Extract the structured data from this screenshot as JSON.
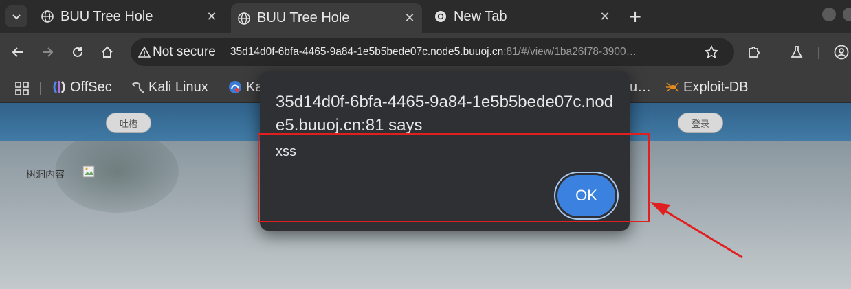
{
  "tabs": [
    {
      "title": "BUU Tree Hole",
      "active": false,
      "favicon": "globe-icon"
    },
    {
      "title": "BUU Tree Hole",
      "active": true,
      "favicon": "globe-icon"
    },
    {
      "title": "New Tab",
      "active": false,
      "favicon": "chrome-icon"
    }
  ],
  "toolbar": {
    "security_label": "Not secure",
    "url_host": "35d14d0f-6bfa-4465-9a84-1e5b5bede07c.node5.buuoj.cn",
    "url_rest": ":81/#/view/1ba26f78-3900…"
  },
  "bookmarks": [
    {
      "label": "OffSec",
      "icon": "offsec-icon"
    },
    {
      "label": "Kali Linux",
      "icon": "kali-dragon-icon"
    },
    {
      "label": "Ka",
      "icon": "kali-tools-icon"
    },
    {
      "label": "u…",
      "icon": ""
    },
    {
      "label": "Exploit-DB",
      "icon": "exploitdb-spider-icon"
    }
  ],
  "page": {
    "nav_left_button": "吐槽",
    "nav_right_button": "登录",
    "content_label": "树洞内容"
  },
  "dialog": {
    "title": "35d14d0f-6bfa-4465-9a84-1e5b5bede07c.node5.buuoj.cn:81 says",
    "message": "xss",
    "ok_label": "OK"
  },
  "colors": {
    "annotation": "#e02020",
    "ok_button": "#3b82e0",
    "navbar": "#2a5f8a"
  }
}
